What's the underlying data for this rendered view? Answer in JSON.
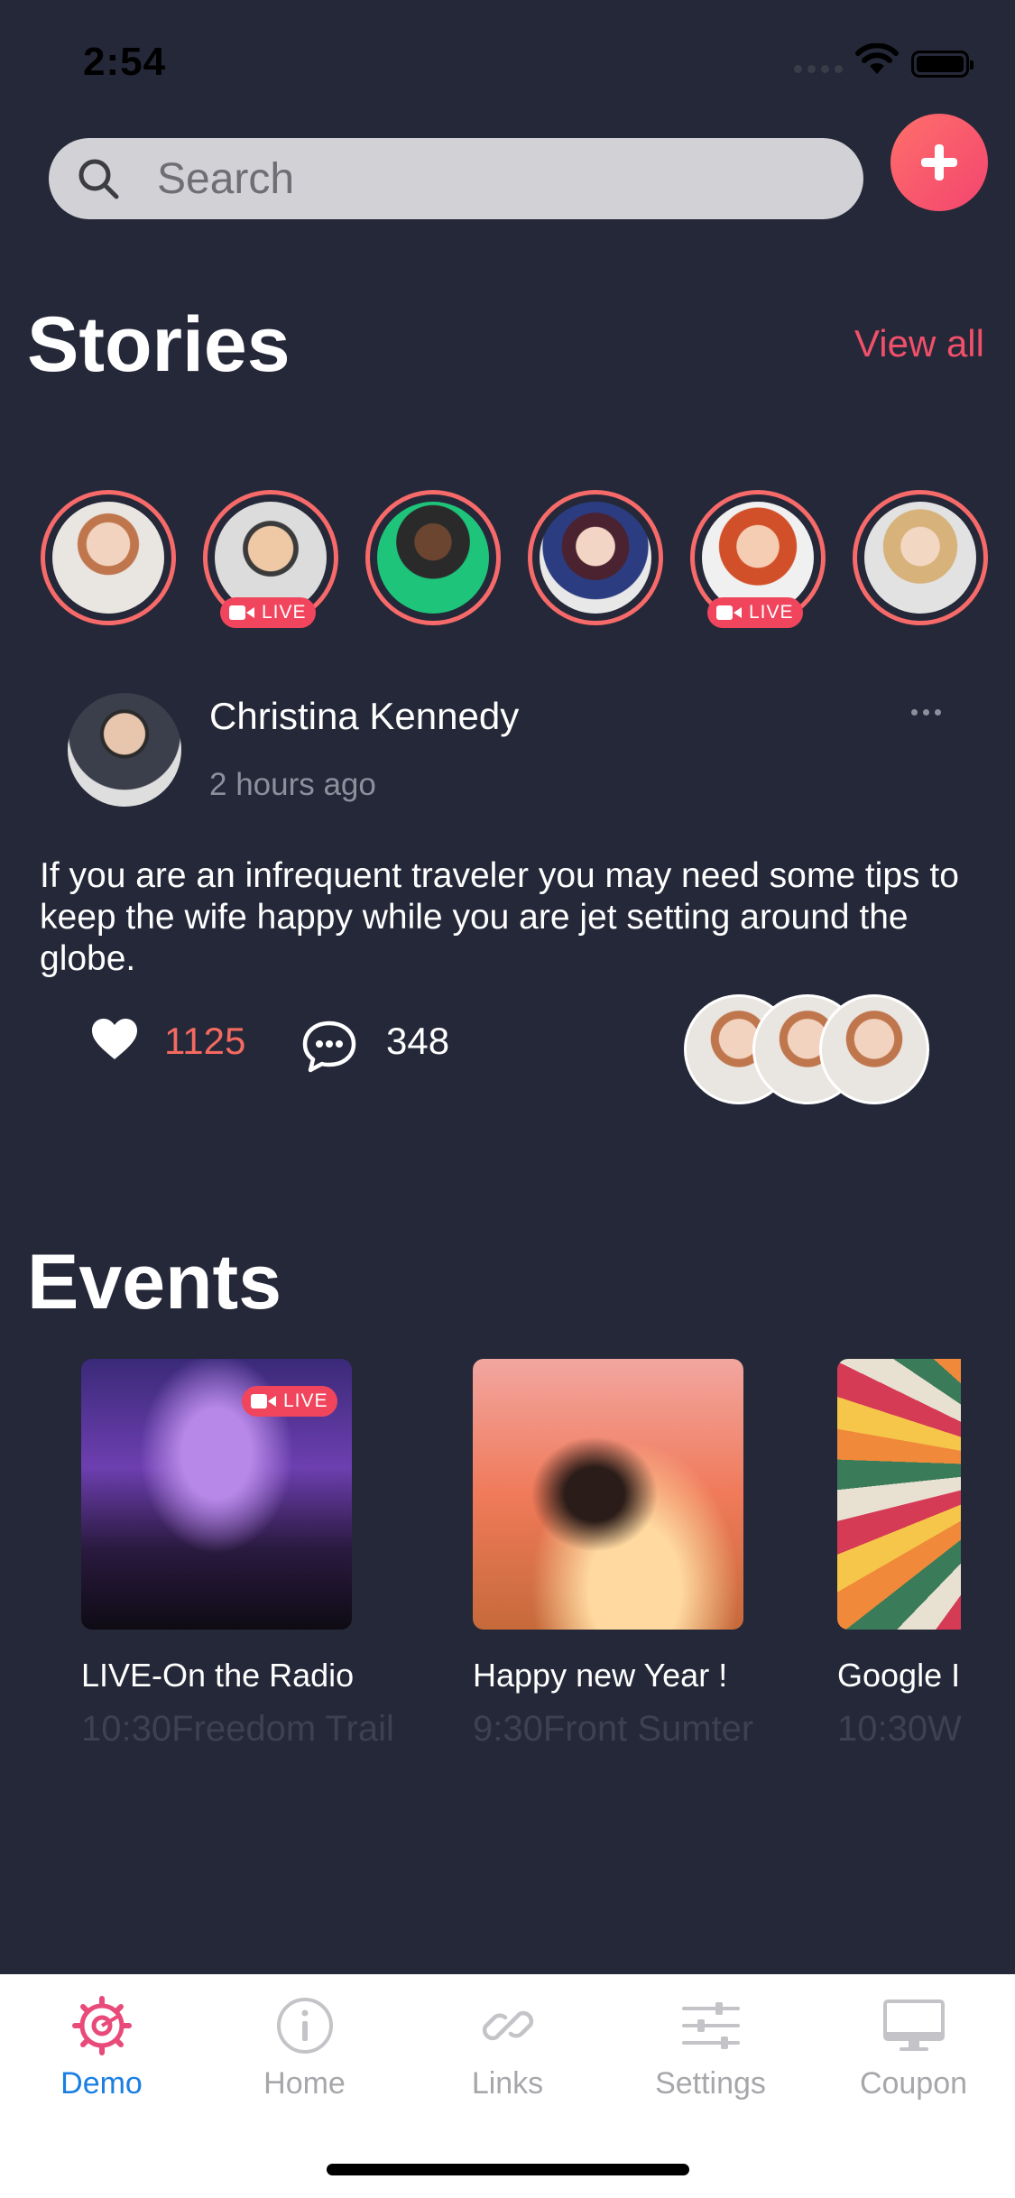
{
  "status_bar": {
    "time": "2:54"
  },
  "search": {
    "placeholder": "Search"
  },
  "stories": {
    "title": "Stories",
    "view_all": "View all",
    "items": [
      {
        "name": "story-1",
        "live": false
      },
      {
        "name": "story-2",
        "live": true,
        "badge": "LIVE"
      },
      {
        "name": "story-3",
        "live": false
      },
      {
        "name": "story-4",
        "live": false
      },
      {
        "name": "story-5",
        "live": true,
        "badge": "LIVE"
      },
      {
        "name": "story-6",
        "live": false
      }
    ]
  },
  "post": {
    "author": "Christina Kennedy",
    "time_ago": "2 hours ago",
    "text": "If you are an infrequent traveler you may need some tips to keep the wife happy while you are jet setting around the globe.",
    "likes": "1125",
    "comments": "348"
  },
  "events": {
    "title": "Events",
    "items": [
      {
        "title": "LIVE-On the Radio",
        "subtitle": "10:30Freedom Trail",
        "badge": "LIVE"
      },
      {
        "title": "Happy new Year !",
        "subtitle": "9:30Front Sumter"
      },
      {
        "title": "Google I",
        "subtitle": "10:30W"
      }
    ]
  },
  "tabbar": {
    "items": [
      {
        "label": "Demo",
        "icon": "gear-icon",
        "active": true
      },
      {
        "label": "Home",
        "icon": "info-icon"
      },
      {
        "label": "Links",
        "icon": "link-icon"
      },
      {
        "label": "Settings",
        "icon": "sliders-icon"
      },
      {
        "label": "Coupon",
        "icon": "monitor-icon"
      }
    ]
  },
  "colors": {
    "background": "#252838",
    "accent": "#f0506a",
    "active_tab": "#1a7fe0"
  }
}
